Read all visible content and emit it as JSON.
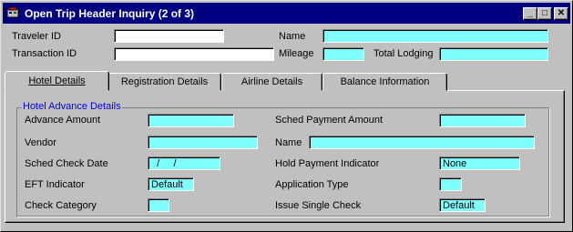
{
  "window": {
    "title": "Open Trip Header Inquiry (2 of 3)",
    "controls": {
      "minimize": "_",
      "maximize": "□",
      "close": "✕"
    }
  },
  "header": {
    "traveler_id": {
      "label": "Traveler ID",
      "value": ""
    },
    "transaction_id": {
      "label": "Transaction ID",
      "value": ""
    },
    "name": {
      "label": "Name",
      "value": ""
    },
    "mileage": {
      "label": "Mileage",
      "value": ""
    },
    "total_lodging": {
      "label": "Total Lodging",
      "value": ""
    }
  },
  "tabs": [
    {
      "label": "Hotel Details",
      "active": true
    },
    {
      "label": "Registration Details",
      "active": false
    },
    {
      "label": "Airline Details",
      "active": false
    },
    {
      "label": "Balance Information",
      "active": false
    }
  ],
  "hotel": {
    "group_title": "Hotel Advance Details",
    "advance_amount": {
      "label": "Advance Amount",
      "value": ""
    },
    "vendor": {
      "label": "Vendor",
      "value": ""
    },
    "sched_check_date": {
      "label": "Sched Check Date",
      "value": "  /     /"
    },
    "eft_indicator": {
      "label": "EFT Indicator",
      "value": "Default"
    },
    "check_category": {
      "label": "Check Category",
      "value": ""
    },
    "sched_payment_amount": {
      "label": "Sched Payment Amount",
      "value": ""
    },
    "name": {
      "label": "Name",
      "value": ""
    },
    "hold_payment_indicator": {
      "label": "Hold Payment Indicator",
      "value": "None"
    },
    "application_type": {
      "label": "Application Type",
      "value": ""
    },
    "issue_single_check": {
      "label": "Issue Single Check",
      "value": "Default"
    }
  },
  "colors": {
    "titlebar": "#000080",
    "field_readonly": "#80ffff",
    "group_title": "#0000ff"
  }
}
